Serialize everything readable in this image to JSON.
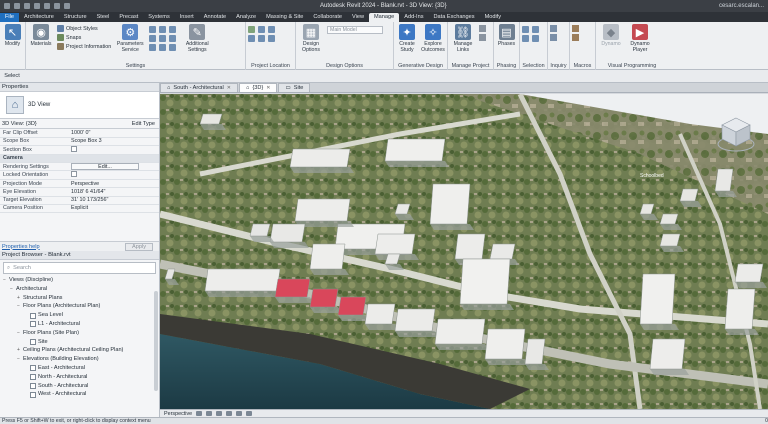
{
  "window": {
    "title": "Autodesk Revit 2024 - Blank.rvt - 3D View: {3D}",
    "user": "cesarc.escalan..."
  },
  "ribbon_tabs": [
    "File",
    "Architecture",
    "Structure",
    "Steel",
    "Precast",
    "Systems",
    "Insert",
    "Annotate",
    "Analyze",
    "Massing & Site",
    "Collaborate",
    "View",
    "Manage",
    "Add-Ins",
    "Data Exchanges",
    "Modify"
  ],
  "ribbon": {
    "modify": "Modify",
    "materials": "Materials",
    "object_styles": "Object Styles",
    "snaps": "Snaps",
    "project_information": "Project Information",
    "parameters_service": "Parameters Service",
    "additional_settings": "Additional Settings",
    "settings_panel": "Settings",
    "project_location_panel": "Project Location",
    "design_options": "Design Options",
    "main_model": "Main Model",
    "design_options_panel": "Design Options",
    "create_study": "Create Study",
    "explore_outcomes": "Explore Outcomes",
    "generative_panel": "Generative Design",
    "manage_links": "Manage Links",
    "manage_project_panel": "Manage Project",
    "phases": "Phases",
    "phasing_panel": "Phasing",
    "selection_panel": "Selection",
    "inquiry_panel": "Inquiry",
    "macros_panel": "Macros",
    "dynamo": "Dynamo",
    "dynamo_player": "Dynamo Player",
    "vp_panel": "Visual Programming",
    "select_label": "Select"
  },
  "properties": {
    "header": "Properties",
    "type_name": "3D View",
    "instance": "3D View: {3D}",
    "edit_type": "Edit Type",
    "rows": [
      {
        "k": "Far Clip Offset",
        "v": "1000' 0\""
      },
      {
        "k": "Scope Box",
        "v": "Scope Box 3"
      },
      {
        "k": "Section Box",
        "v": ""
      },
      {
        "k": "Camera",
        "v": "",
        "cat": true
      },
      {
        "k": "Rendering Settings",
        "v": "Edit..."
      },
      {
        "k": "Locked Orientation",
        "v": ""
      },
      {
        "k": "Projection Mode",
        "v": "Perspective"
      },
      {
        "k": "Eye Elevation",
        "v": "1018' 6 41/64\""
      },
      {
        "k": "Target Elevation",
        "v": "31' 10 173/256\""
      },
      {
        "k": "Camera Position",
        "v": "Explicit"
      }
    ],
    "help": "Properties help",
    "apply": "Apply"
  },
  "browser": {
    "header": "Project Browser - Blank.rvt",
    "search_placeholder": "Search",
    "nodes": [
      {
        "t": "Views (Discipline)",
        "lvl": 0,
        "tw": "−"
      },
      {
        "t": "Architectural",
        "lvl": 1,
        "tw": "−"
      },
      {
        "t": "Structural Plans",
        "lvl": 2,
        "tw": "+"
      },
      {
        "t": "Floor Plans (Architectural Plan)",
        "lvl": 2,
        "tw": "−"
      },
      {
        "t": "Sea Level",
        "lvl": 3,
        "tw": "",
        "icon": true
      },
      {
        "t": "L1 - Architectural",
        "lvl": 3,
        "tw": "",
        "icon": true
      },
      {
        "t": "Floor Plans (Site Plan)",
        "lvl": 2,
        "tw": "−"
      },
      {
        "t": "Site",
        "lvl": 3,
        "tw": "",
        "icon": true
      },
      {
        "t": "Ceiling Plans (Architectural Ceiling Plan)",
        "lvl": 2,
        "tw": "+"
      },
      {
        "t": "Elevations (Building Elevation)",
        "lvl": 2,
        "tw": "−"
      },
      {
        "t": "East - Architectural",
        "lvl": 3,
        "tw": "",
        "icon": true
      },
      {
        "t": "North - Architectural",
        "lvl": 3,
        "tw": "",
        "icon": true
      },
      {
        "t": "South - Architectural",
        "lvl": 3,
        "tw": "",
        "icon": true
      },
      {
        "t": "West - Architectural",
        "lvl": 3,
        "tw": "",
        "icon": true
      }
    ]
  },
  "view_tabs": [
    {
      "label": "South - Architectural",
      "active": false
    },
    {
      "label": "{3D}",
      "active": true
    },
    {
      "label": "Site",
      "active": false
    }
  ],
  "viewport": {
    "label_small": "Schoolbed",
    "mode": "Perspective"
  },
  "status": {
    "text": "Press F5 or Shift+W to exit, or right-click to display context menu",
    "right": "0"
  }
}
